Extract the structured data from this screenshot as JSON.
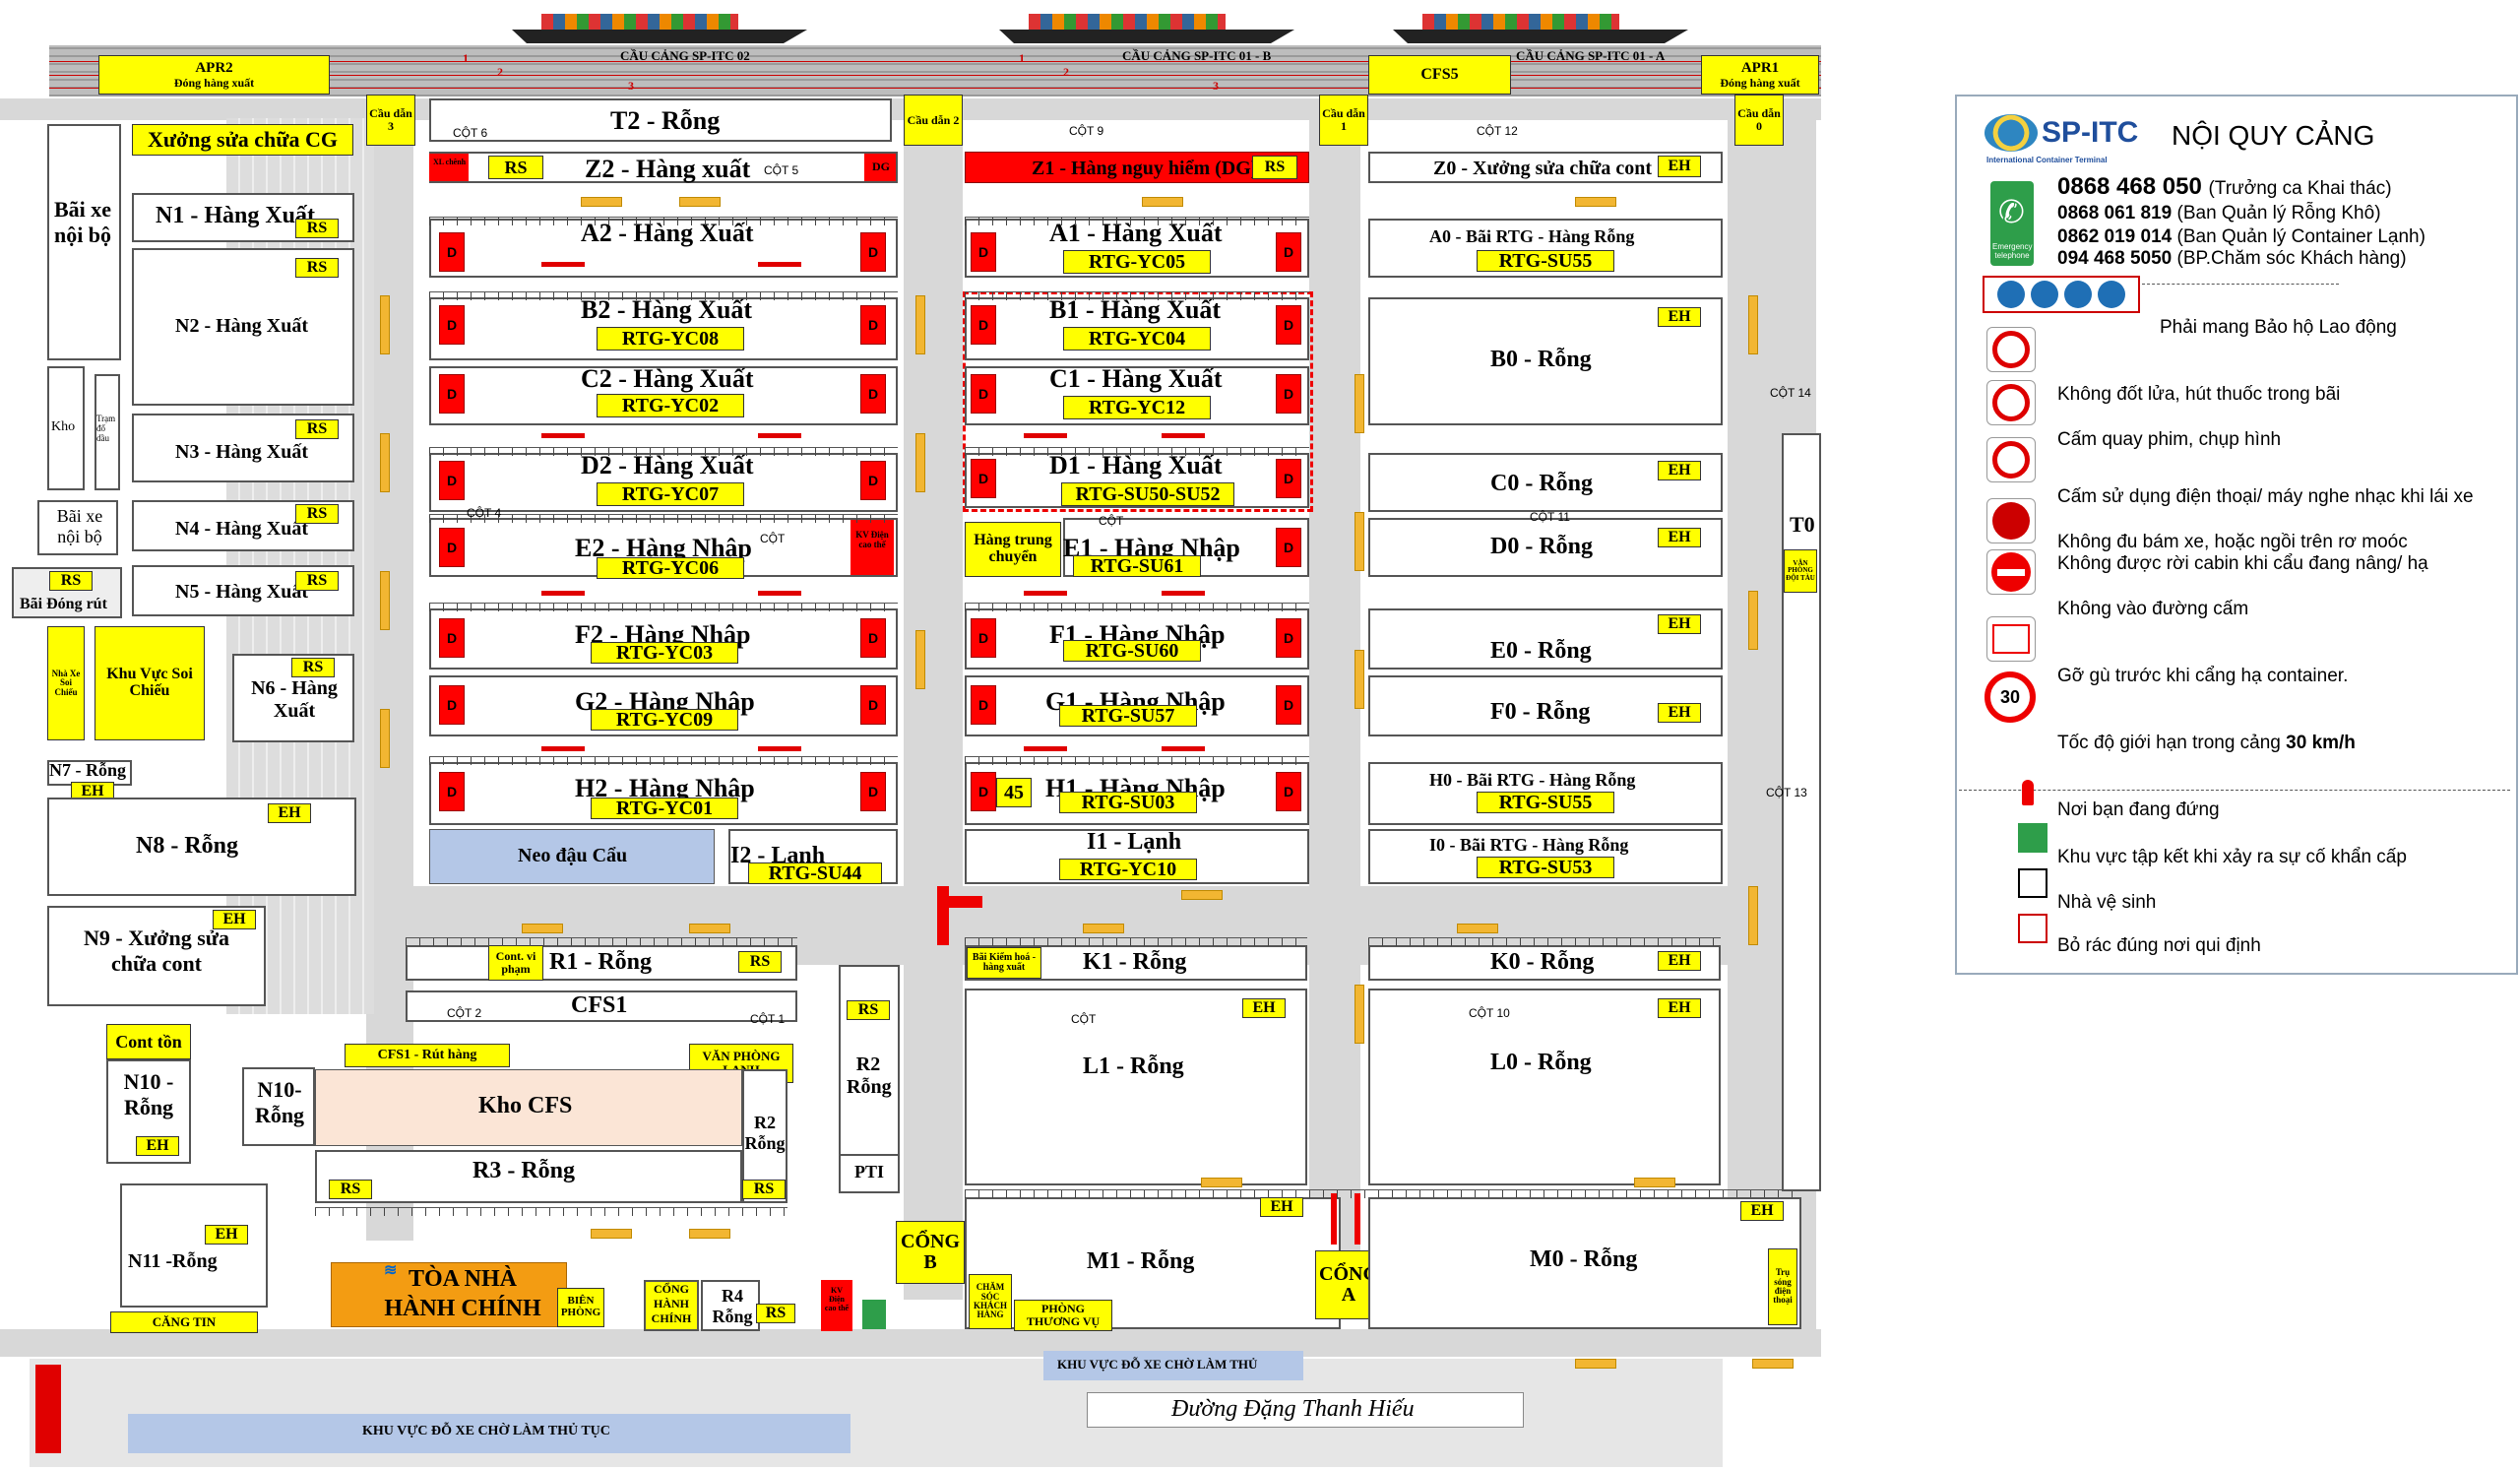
{
  "quay": {
    "labels": [
      "CẦU CẢNG SP-ITC 02",
      "CẦU CẢNG SP-ITC 01 - B",
      "CẦU CẢNG SP-ITC 01 - A"
    ],
    "lane_numbers": [
      "1",
      "2",
      "3",
      "1",
      "2",
      "3"
    ],
    "apr2": "APR2",
    "apr2_sub": "Đóng hàng xuất",
    "apr1": "APR1",
    "apr1_sub": "Đóng hàng xuất",
    "cfs5": "CFS5"
  },
  "gates": {
    "g3": "Cầu dẫn 3",
    "g2": "Cầu dẫn 2",
    "g1": "Cầu dẫn 1",
    "g0": "Cầu dẫn 0"
  },
  "left": {
    "xuong_cg": "Xưởng sửa chữa CG",
    "bai_xe_noi_bo": "Bãi xe nội bộ",
    "kho": "Kho",
    "tram": "Trạm đổ dầu",
    "bai_xe2": "Bãi xe nội bộ",
    "bai_dong_rut": "Bãi Đóng rút",
    "n1": "N1 - Hàng Xuất",
    "n2": "N2 - Hàng Xuất",
    "n3": "N3 - Hàng Xuất",
    "n4": "N4 - Hàng Xuất",
    "n5": "N5 - Hàng Xuất",
    "n6": "N6 - Hàng Xuất",
    "n7": "N7 - Rỗng",
    "n8": "N8 - Rỗng",
    "n9": "N9 - Xưởng sửa chữa cont",
    "nha_xe": "Nhà Xe Soi Chiếu",
    "khu_soi": "Khu Vực Soi Chiếu",
    "cont_ton": "Cont tồn",
    "n10": "N10 -Rỗng",
    "n11": "N11 -Rỗng",
    "cang_tin": "CĂNG TIN",
    "toa_nha": "TÒA NHÀ HÀNH CHÍNH",
    "bien_phong": "BIÊN PHÒNG",
    "cong_hanh_chinh": "CỔNG HÀNH CHÍNH",
    "khu_do_xe": "KHU VỰC ĐỖ XE CHỜ LÀM THỦ TỤC"
  },
  "tags": {
    "RS": "RS",
    "EH": "EH",
    "D": "D",
    "DG": "DG",
    "RS_blank": "RS"
  },
  "mid": {
    "t2": "T2 - Rỗng",
    "z2": "Z2 - Hàng xuất",
    "z2_rs": "RS",
    "z2_dg": "DG",
    "z2_small": "XL chênh",
    "a2": "A2 - Hàng Xuất",
    "b2": "B2 - Hàng Xuất",
    "b2_rtg": "RTG-YC08",
    "c2": "C2 - Hàng Xuất",
    "c2_rtg": "RTG-YC02",
    "d2": "D2 - Hàng Xuất",
    "d2_rtg": "RTG-YC07",
    "e2": "E2 - Hàng Nhập",
    "e2_rtg": "RTG-YC06",
    "kv_dien": "KV Điện cao thế",
    "f2": "F2 - Hàng Nhập",
    "f2_rtg": "RTG-YC03",
    "g2": "G2 - Hàng Nhập",
    "g2_rtg": "RTG-YC09",
    "h2": "H2 - Hàng Nhập",
    "h2_rtg": "RTG-YC01",
    "neo_dau": "Neo đậu Cẩu",
    "i2": "I2 - Lạnh",
    "i2_rtg": "RTG-SU44",
    "r1": "R1 - Rỗng",
    "cont_vp": "Cont. vi phạm",
    "cfs1": "CFS1",
    "cfs1_rut": "CFS1 - Rút hàng",
    "vp_lanh": "VĂN PHÒNG LẠNH",
    "n10_rong": "N10- Rỗng",
    "kho_cfs": "Kho CFS",
    "r2a": "R2 Rỗng",
    "r3": "R3 - Rỗng",
    "r2": "R2 Rỗng",
    "pti": "PTI",
    "r4": "R4 Rỗng",
    "kv_dien2": "KV Điện cao thế"
  },
  "right": {
    "z1": "Z1 - Hàng nguy hiểm (DG)",
    "a1": "A1 - Hàng Xuất",
    "a1_rtg": "RTG-YC05",
    "b1": "B1 - Hàng Xuất",
    "b1_rtg": "RTG-YC04",
    "c1": "C1 - Hàng Xuất",
    "c1_rtg": "RTG-YC12",
    "d1": "D1 - Hàng Xuất",
    "d1_rtg": "RTG-SU50-SU52",
    "ht": "Hàng trung chuyển",
    "e1": "E1 - Hàng Nhập",
    "e1_rtg": "RTG-SU61",
    "f1": "F1 - Hàng Nhập",
    "f1_rtg": "RTG-SU60",
    "g1": "G1 - Hàng Nhập",
    "g1_rtg": "RTG-SU57",
    "h1": "H1 - Hàng Nhập",
    "h1_rtg": "RTG-SU03",
    "h1_45": "45",
    "i1": "I1 - Lạnh",
    "i1_rtg": "RTG-YC10",
    "k1": "K1 - Rỗng",
    "bai_kiem": "Bãi Kiểm hoá - hàng xuất",
    "l1": "L1 - Rỗng",
    "m1": "M1 - Rỗng",
    "cong_b": "CỔNG B",
    "cham_soc": "CHĂM SÓC KHÁCH HÀNG",
    "phong_tv": "PHÒNG THƯƠNG VỤ",
    "z0": "Z0 - Xưởng sửa chữa cont",
    "a0": "A0 - Bãi RTG - Hàng Rỗng",
    "a0_rtg": "RTG-SU55",
    "b0": "B0 - Rỗng",
    "c0": "C0 - Rỗng",
    "d0": "D0 - Rỗng",
    "e0": "E0 - Rỗng",
    "f0": "F0 - Rỗng",
    "h0": "H0 - Bãi RTG - Hàng Rỗng",
    "h0_rtg": "RTG-SU55",
    "i0": "I0 - Bãi RTG - Hàng Rỗng",
    "i0_rtg": "RTG-SU53",
    "k0": "K0 - Rỗng",
    "l0": "L0 - Rỗng",
    "m0": "M0 - Rỗng",
    "cong_a": "CỔNG A",
    "t0": "T0",
    "vp_t0": "VĂN PHÒNG ĐỘI TÀU",
    "tru_song": "Trụ sóng điện thoại",
    "khu_do_lam_thu": "KHU VỰC ĐỖ XE CHỜ LÀM THỦ",
    "duong": "Đường Đặng Thanh Hiếu"
  },
  "columns": {
    "c1": "CỘT 1",
    "c2": "CỘT 2",
    "c4": "CỘT 4",
    "c5": "CỘT 5",
    "c6": "CỘT 6",
    "c9": "CỘT 9",
    "c10": "CỘT 10",
    "c11": "CỘT 11",
    "c12": "CỘT 12",
    "c13": "CỘT 13",
    "c14": "CỘT 14",
    "cot": "CỘT"
  },
  "rules": {
    "brand": "SP-ITC",
    "brand_sub": "International Container Terminal",
    "title": "NỘI QUY CẢNG",
    "hotline": "0868 468 050",
    "hotline_note": "(Trưởng ca Khai thác)",
    "phone2": "0868 061 819",
    "phone2_note": "(Ban Quản lý  Rỗng Khô)",
    "phone3": "0862 019 014",
    "phone3_note": "(Ban Quản lý  Container Lạnh)",
    "phone4": "094 468 5050",
    "phone4_note": "(BP.Chăm sóc Khách hàng)",
    "emergency": "Emergency telephone",
    "ppe": "Phải mang Bảo hộ Lao động",
    "r1": "Không đốt lửa, hút thuốc trong bãi",
    "r2": "Cấm quay phim, chụp hình",
    "r3": "Cấm sử dụng điện thoại/ máy nghe nhạc khi lái xe",
    "r4a": "Không đu bám xe, hoặc ngồi trên rơ moóc",
    "r4b": "Không được rời cabin khi cẩu đang nâng/ hạ",
    "r5": "Không vào đường cấm",
    "r6": "Gỡ gù trước khi cẩng hạ container.",
    "speed_sign": "30",
    "r7a": "Tốc độ giới hạn trong cảng ",
    "r7b": "30 km/h",
    "l1": "Nơi bạn đang đứng",
    "l2": "Khu vực tập kết khi xảy ra sự cố khẩn cấp",
    "l3": "Nhà vệ sinh",
    "l4": "Bỏ rác đúng nơi qui định"
  },
  "colors": {
    "yellow": "#ffff00",
    "red": "#ff0000",
    "orange": "#f2b632",
    "road": "#d8d8d8",
    "blue": "#b4c7e7"
  }
}
